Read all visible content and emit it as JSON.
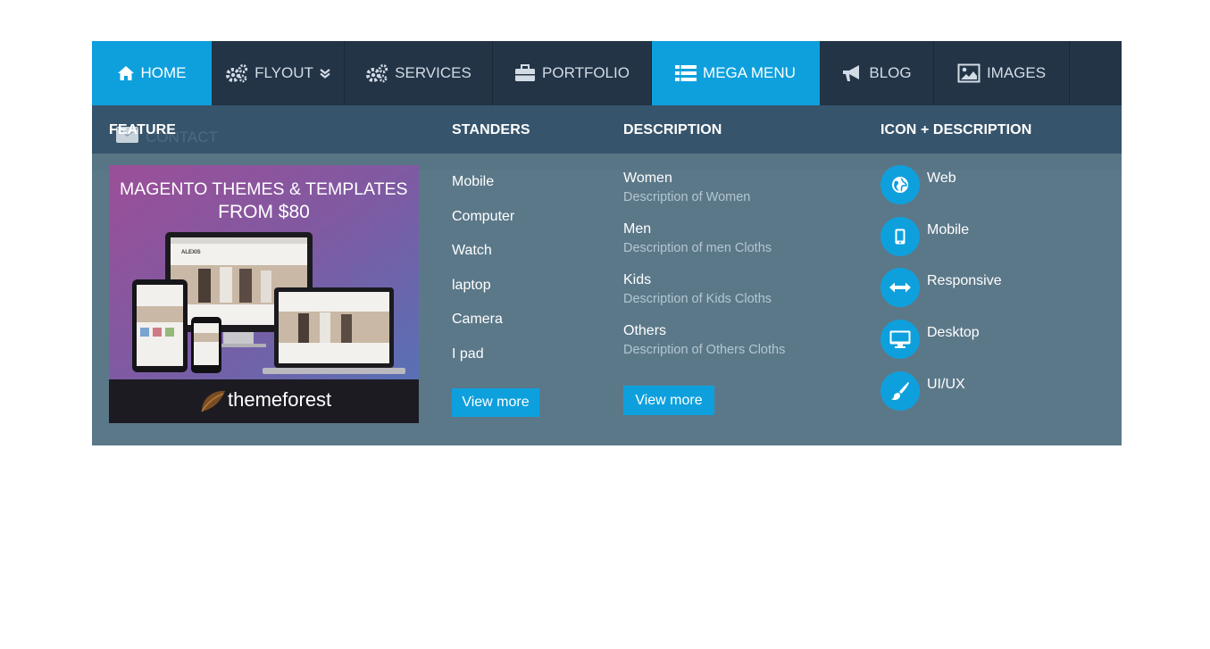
{
  "nav": {
    "items": [
      {
        "label": "HOME",
        "icon": "home-icon",
        "active": true
      },
      {
        "label": "FLYOUT",
        "icon": "gears-icon",
        "active": false
      },
      {
        "label": "SERVICES",
        "icon": "gears-icon",
        "active": false
      },
      {
        "label": "PORTFOLIO",
        "icon": "briefcase-icon",
        "active": false
      },
      {
        "label": "MEGA MENU",
        "icon": "list-icon",
        "active": true
      },
      {
        "label": "BLOG",
        "icon": "bullhorn-icon",
        "active": false
      },
      {
        "label": "IMAGES",
        "icon": "image-icon",
        "active": false
      }
    ]
  },
  "mega": {
    "ghost_contact": "CONTACT",
    "columns": {
      "feature": "FEATURE",
      "standers": "STANDERS",
      "description": "DESCRIPTION",
      "icon_description": "ICON + DESCRIPTION"
    },
    "banner": {
      "line1": "MAGENTO THEMES & TEMPLATES",
      "line2": "FROM $80",
      "brand": "themeforest",
      "screen_brand": "ALEXIS"
    },
    "standers": [
      "Mobile",
      "Computer",
      "Watch",
      "laptop",
      "Camera",
      "I pad"
    ],
    "standers_button": "View more",
    "descriptions": [
      {
        "title": "Women",
        "desc": "Description of Women"
      },
      {
        "title": "Men",
        "desc": "Description of men Cloths"
      },
      {
        "title": "Kids",
        "desc": "Description of Kids Cloths"
      },
      {
        "title": "Others",
        "desc": "Description of Others Cloths"
      }
    ],
    "description_button": "View more",
    "icon_items": [
      {
        "label": "Web",
        "icon": "globe-icon"
      },
      {
        "label": "Mobile",
        "icon": "mobile-icon"
      },
      {
        "label": "Responsive",
        "icon": "arrows-horizontal-icon"
      },
      {
        "label": "Desktop",
        "icon": "desktop-icon"
      },
      {
        "label": "UI/UX",
        "icon": "paintbrush-icon"
      }
    ]
  },
  "colors": {
    "nav_bg": "#233447",
    "accent": "#0ea0dd",
    "mega_bg": "#5b7889",
    "mega_header_bg": "#36546b"
  }
}
